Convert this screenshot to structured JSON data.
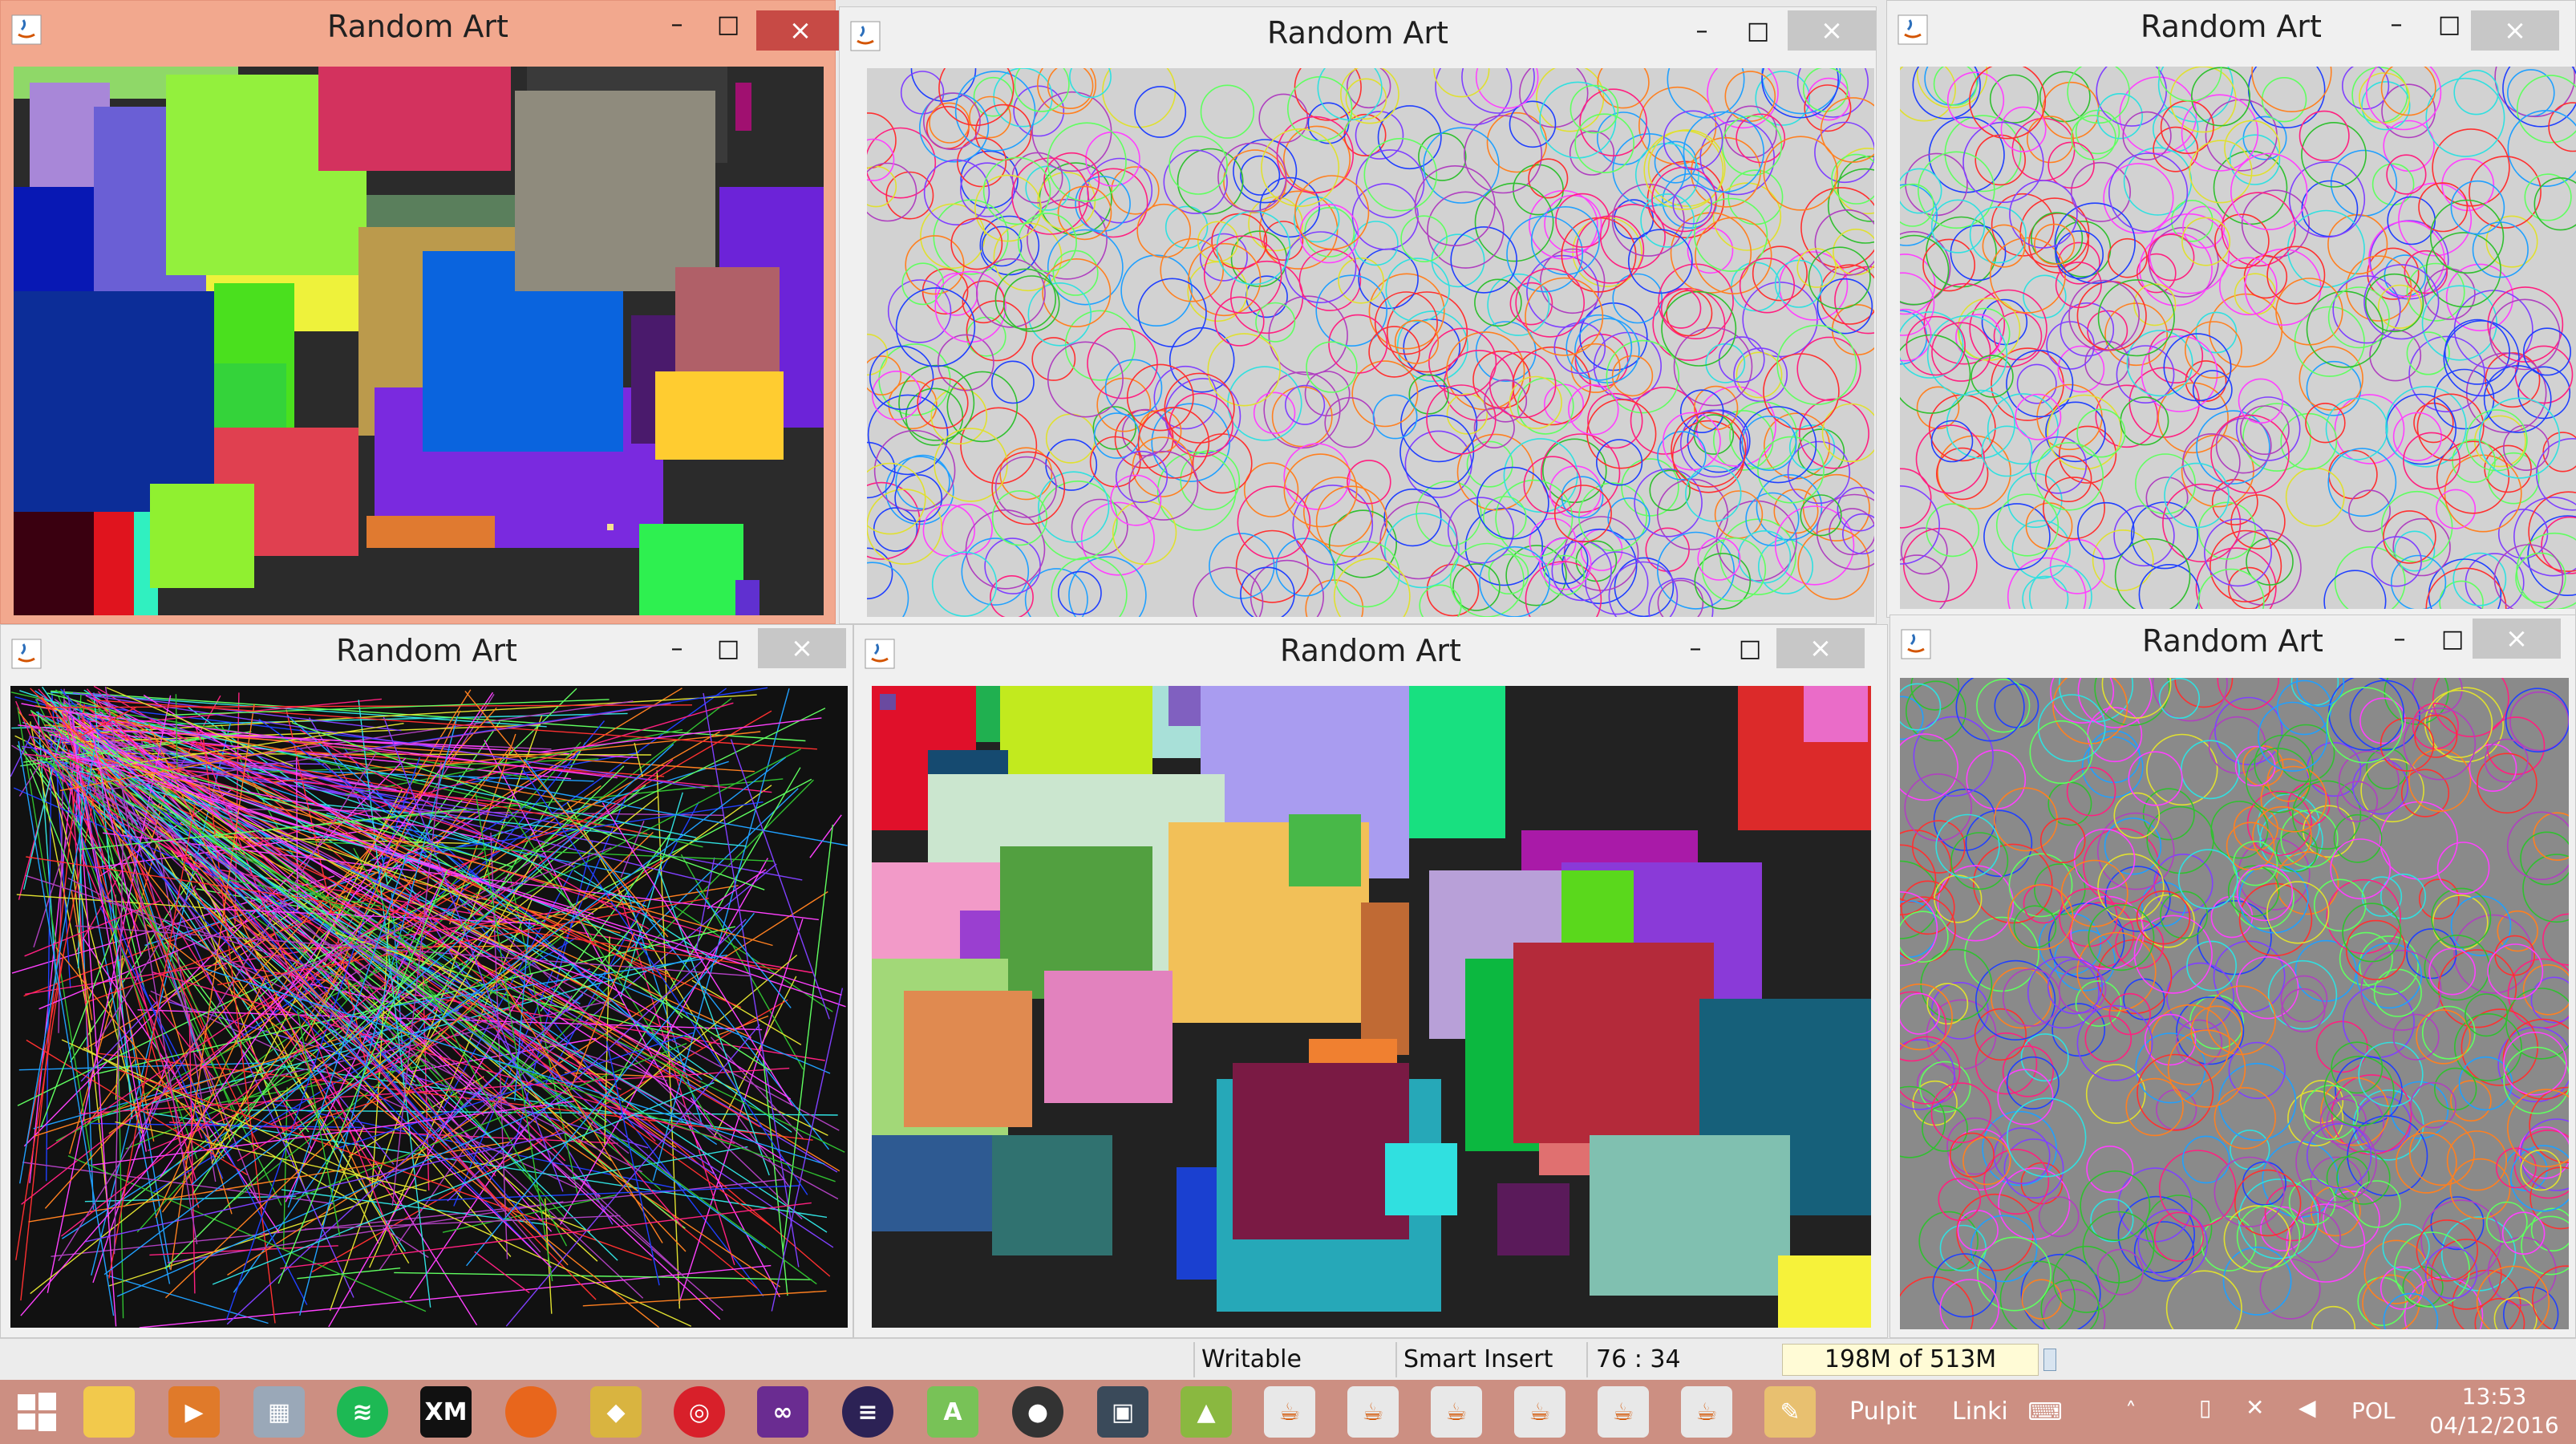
{
  "window_title": "Random Art",
  "controls": {
    "minimize": "–",
    "maximize": "□",
    "close": "×"
  },
  "status": {
    "mode": "Writable",
    "insert": "Smart Insert",
    "position": "76 : 34",
    "memory": "198M of 513M"
  },
  "taskbar": {
    "pulpit": "Pulpit",
    "linki": "Linki",
    "language": "POL",
    "time": "13:53",
    "date": "04/12/2016",
    "apps": [
      "windows-start",
      "file-explorer",
      "media-player",
      "calculator",
      "spotify",
      "xm",
      "firefox",
      "maps",
      "camera",
      "visual-studio",
      "eclipse",
      "android-studio",
      "github",
      "code-app",
      "image-app",
      "java",
      "java",
      "java",
      "java",
      "java",
      "java",
      "paint"
    ]
  },
  "colors": {
    "active_title": "#f2a88e",
    "close_active": "#c74a45",
    "taskbar": "#cc8f82",
    "canvas_dark": "#2b2b2b",
    "canvas_light": "#d2d2d2",
    "canvas_grey": "#8a8a8a"
  }
}
